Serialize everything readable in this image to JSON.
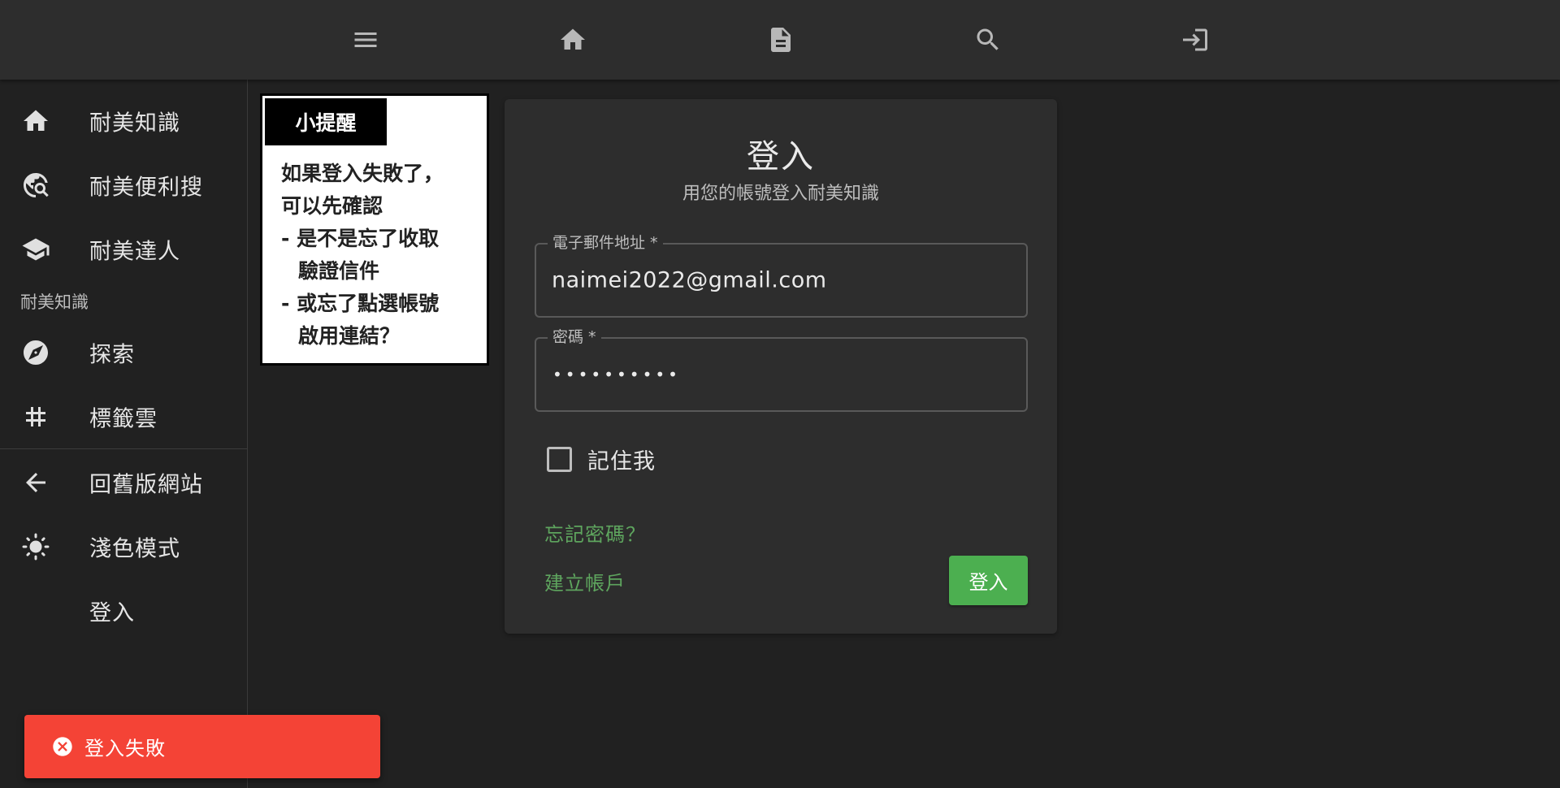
{
  "topbar": {
    "icons": [
      "menu-icon",
      "home-icon",
      "document-icon",
      "search-icon",
      "login-icon"
    ]
  },
  "sidebar": {
    "items": [
      {
        "label": "耐美知識",
        "icon": "home-icon"
      },
      {
        "label": "耐美便利搜",
        "icon": "travel-explore-icon"
      },
      {
        "label": "耐美達人",
        "icon": "school-icon"
      }
    ],
    "subheader": "耐美知識",
    "section_items": [
      {
        "label": "探索",
        "icon": "compass-icon"
      },
      {
        "label": "標籤雲",
        "icon": "hashtag-icon"
      }
    ],
    "footer_items": [
      {
        "label": "回舊版網站",
        "icon": "arrow-left-icon"
      },
      {
        "label": "淺色模式",
        "icon": "sun-icon"
      },
      {
        "label": "登入",
        "icon": ""
      }
    ]
  },
  "tip": {
    "title": "小提醒",
    "lines": [
      "如果登入失敗了，",
      "可以先確認",
      "- 是不是忘了收取",
      "驗證信件",
      "- 或忘了點選帳號",
      "啟用連結？"
    ]
  },
  "login": {
    "title": "登入",
    "subtitle": "用您的帳號登入耐美知識",
    "email": {
      "label": "電子郵件地址 *",
      "value": "naimei2022@gmail.com"
    },
    "password": {
      "label": "密碼 *",
      "value": "••••••••••"
    },
    "remember_label": "記住我",
    "remember_checked": false,
    "forgot_link": "忘記密碼？",
    "create_link": "建立帳戶",
    "submit_label": "登入"
  },
  "snackbar": {
    "icon": "error-circle-icon",
    "text": "登入失敗"
  },
  "colors": {
    "background": "#212121",
    "appbar": "#2d2d2d",
    "card": "#2d2d2d",
    "accent_green": "#4caf50",
    "link_green": "#5ea55e",
    "error_red": "#f44336"
  }
}
